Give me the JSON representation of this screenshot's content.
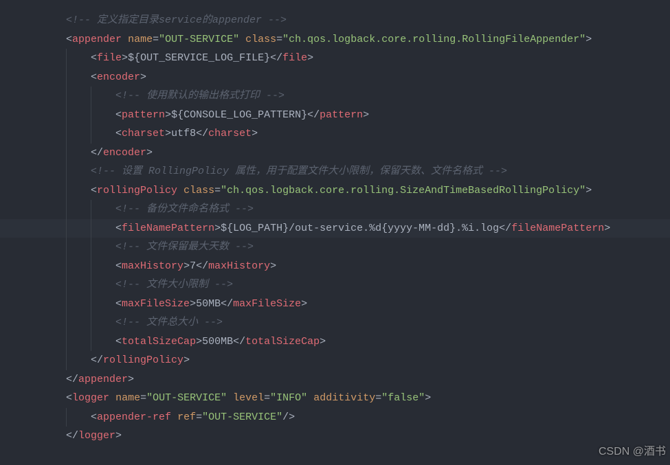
{
  "lines": [
    {
      "indent": 1,
      "type": "comment",
      "text": "<!-- 定义指定目录service的appender -->"
    },
    {
      "indent": 1,
      "type": "open",
      "tag": "appender",
      "attrs": [
        [
          "name",
          "OUT-SERVICE"
        ],
        [
          "class",
          "ch.qos.logback.core.rolling.RollingFileAppender"
        ]
      ]
    },
    {
      "indent": 2,
      "type": "leaf",
      "tag": "file",
      "content": "${OUT_SERVICE_LOG_FILE}"
    },
    {
      "indent": 2,
      "type": "open",
      "tag": "encoder"
    },
    {
      "indent": 3,
      "type": "comment",
      "text": "<!-- 使用默认的输出格式打印 -->"
    },
    {
      "indent": 3,
      "type": "leaf",
      "tag": "pattern",
      "content": "${CONSOLE_LOG_PATTERN}"
    },
    {
      "indent": 3,
      "type": "leaf",
      "tag": "charset",
      "content": "utf8"
    },
    {
      "indent": 2,
      "type": "close",
      "tag": "encoder"
    },
    {
      "indent": 2,
      "type": "comment",
      "text": "<!-- 设置 RollingPolicy 属性，用于配置文件大小限制，保留天数、文件名格式 -->"
    },
    {
      "indent": 2,
      "type": "open",
      "tag": "rollingPolicy",
      "attrs": [
        [
          "class",
          "ch.qos.logback.core.rolling.SizeAndTimeBasedRollingPolicy"
        ]
      ]
    },
    {
      "indent": 3,
      "type": "comment",
      "text": "<!-- 备份文件命名格式 -->"
    },
    {
      "indent": 3,
      "type": "leaf",
      "tag": "fileNamePattern",
      "content": "${LOG_PATH}/out-service.%d{yyyy-MM-dd}.%i.log",
      "highlight": true
    },
    {
      "indent": 3,
      "type": "comment",
      "text": "<!-- 文件保留最大天数 -->"
    },
    {
      "indent": 3,
      "type": "leaf",
      "tag": "maxHistory",
      "content": "7"
    },
    {
      "indent": 3,
      "type": "comment",
      "text": "<!-- 文件大小限制 -->"
    },
    {
      "indent": 3,
      "type": "leaf",
      "tag": "maxFileSize",
      "content": "50MB"
    },
    {
      "indent": 3,
      "type": "comment",
      "text": "<!-- 文件总大小 -->"
    },
    {
      "indent": 3,
      "type": "leaf",
      "tag": "totalSizeCap",
      "content": "500MB"
    },
    {
      "indent": 2,
      "type": "close",
      "tag": "rollingPolicy"
    },
    {
      "indent": 1,
      "type": "close",
      "tag": "appender"
    },
    {
      "indent": 1,
      "type": "open",
      "tag": "logger",
      "attrs": [
        [
          "name",
          "OUT-SERVICE"
        ],
        [
          "level",
          "INFO"
        ],
        [
          "additivity",
          "false"
        ]
      ]
    },
    {
      "indent": 2,
      "type": "self",
      "tag": "appender-ref",
      "attrs": [
        [
          "ref",
          "OUT-SERVICE"
        ]
      ]
    },
    {
      "indent": 1,
      "type": "close",
      "tag": "logger"
    }
  ],
  "watermark": "CSDN @酒书"
}
